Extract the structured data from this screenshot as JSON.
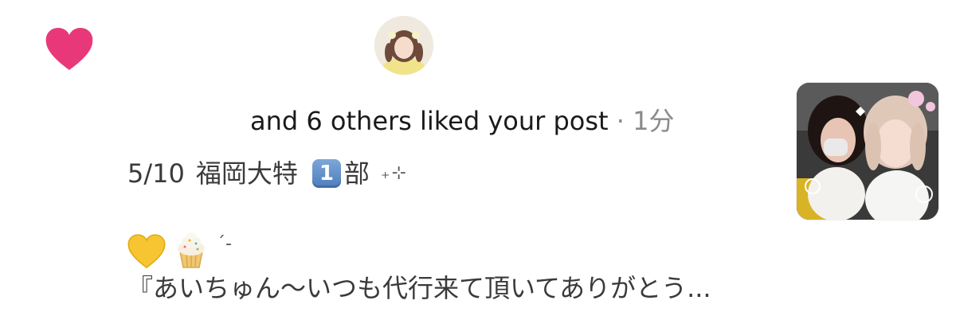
{
  "notification": {
    "type_icon": "heart-icon",
    "accent_color": "#e8387a",
    "text": "and 6 others liked your post",
    "separator": " · ",
    "time": "1分"
  },
  "post": {
    "date": "5/10",
    "place": "福岡大特",
    "keycap": "1",
    "part": "部",
    "sparkle": "₊⊹",
    "emojis": [
      "yellow-heart-icon",
      "cupcake-icon"
    ],
    "deco": "´-",
    "quote": "『あいちゅん～いつも代行来て頂いてありがとう..."
  },
  "avatar": {
    "name": "user-avatar"
  },
  "thumbnail": {
    "name": "post-thumbnail"
  }
}
